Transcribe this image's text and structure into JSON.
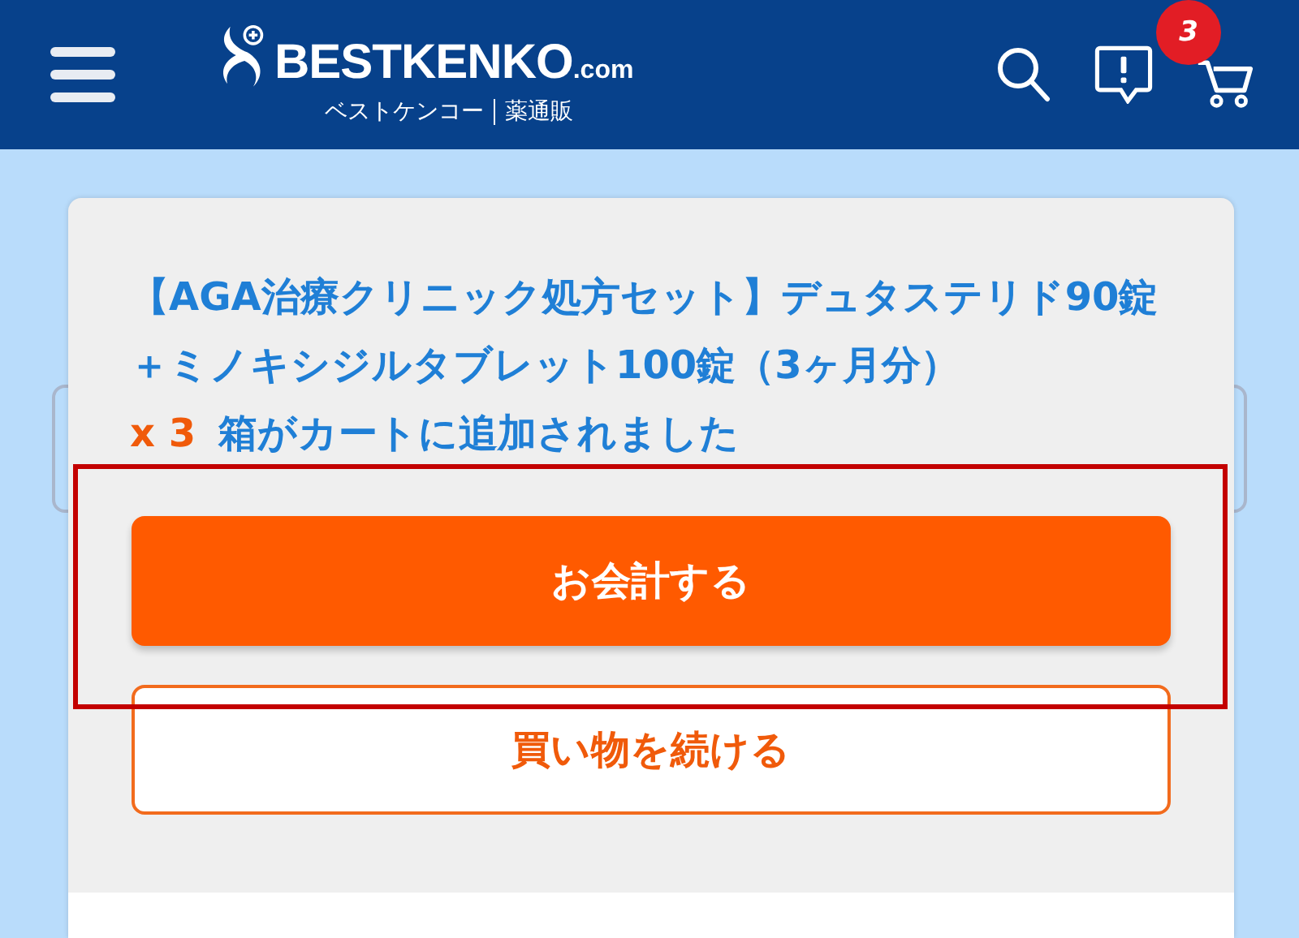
{
  "header": {
    "logo": {
      "name": "BESTKENKO",
      "suffix": ".com",
      "tagline": [
        "ベストケンコー",
        "薬通販"
      ]
    },
    "cart_count": "3"
  },
  "dialog": {
    "product_title": "【AGA治療クリニック処方セット】デュタステリド90錠＋ミノキシジルタブレット100錠（3ヶ月分）",
    "quantity": "x 3",
    "message": "箱がカートに追加されました",
    "checkout_button": "お会計する",
    "continue_button": "買い物を続ける",
    "checkout_highlighted": true
  }
}
